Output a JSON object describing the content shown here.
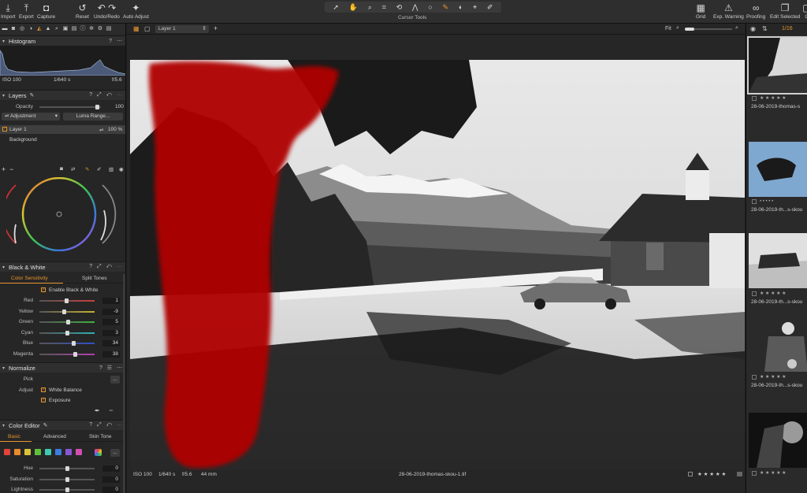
{
  "toolbar": {
    "import": "Import",
    "export": "Export",
    "capture": "Capture",
    "reset": "Reset",
    "undo_redo": "Undo/Redo",
    "auto_adjust": "Auto Adjust",
    "cursor_tools": "Cursor Tools",
    "grid": "Grid",
    "exp_warning": "Exp. Warning",
    "proofing": "Proofing",
    "edit_selected": "Edit Selected",
    "edit_overflow": "C"
  },
  "histogram": {
    "title": "Histogram",
    "iso": "ISO 100",
    "shutter": "1/640 s",
    "aperture": "f/5.6"
  },
  "layers": {
    "title": "Layers",
    "opacity_label": "Opacity",
    "opacity_value": "100",
    "adjustment_label": "Adjustment",
    "luma_range": "Luma Range...",
    "layer1": "Layer 1",
    "layer1_opacity": "100 %",
    "background": "Background"
  },
  "bw": {
    "title": "Black & White",
    "tab_color": "Color Sensitivity",
    "tab_split": "Split Tones",
    "enable": "Enable Black & White",
    "sliders": [
      {
        "label": "Red",
        "value": "1"
      },
      {
        "label": "Yellow",
        "value": "-9"
      },
      {
        "label": "Green",
        "value": "5"
      },
      {
        "label": "Cyan",
        "value": "3"
      },
      {
        "label": "Blue",
        "value": "34"
      },
      {
        "label": "Magenta",
        "value": "38"
      }
    ]
  },
  "normalize": {
    "title": "Normalize",
    "pick": "Pick",
    "pick_button": "...",
    "adjust": "Adjust",
    "white_balance": "White Balance",
    "exposure": "Exposure"
  },
  "color_editor": {
    "title": "Color Editor",
    "tab_basic": "Basic",
    "tab_advanced": "Advanced",
    "tab_skin": "Skin Tone",
    "more": "...",
    "swatches": [
      "#e0443c",
      "#e88a2e",
      "#d9c23a",
      "#5fbf3e",
      "#3ec9b0",
      "#3c7de0",
      "#8a56d6",
      "#d04fb0"
    ],
    "sliders": [
      {
        "label": "Hue",
        "value": "0"
      },
      {
        "label": "Saturation",
        "value": "0"
      },
      {
        "label": "Lightness",
        "value": "0"
      }
    ]
  },
  "viewer": {
    "layer_select": "Layer 1",
    "fit": "Fit",
    "iso": "ISO 100",
    "shutter": "1/640 s",
    "aperture": "f/5.6",
    "focal": "44 mm",
    "filename": "28-06-2019-thomas-skou-1.tif",
    "rating": "★ ★ ★ ★ ★"
  },
  "browser": {
    "counter": "1/16",
    "thumbs": [
      {
        "name": "28-06-2019-thomas-s",
        "rating": "★ ★ ★ ★ ★"
      },
      {
        "name": "28-06-2019-th...s-skou",
        "rating": "• • • • •"
      },
      {
        "name": "28-06-2019-th...s-skou",
        "rating": "★ ★ ★ ★ ★"
      },
      {
        "name": "28-06-2019-th...s-skou",
        "rating": "★ ★ ★ ★ ★"
      },
      {
        "name": "",
        "rating": "★ ★ ★ ★ ★"
      }
    ]
  },
  "colors": {
    "accent": "#e8962e",
    "mask_red": "#b00000"
  }
}
